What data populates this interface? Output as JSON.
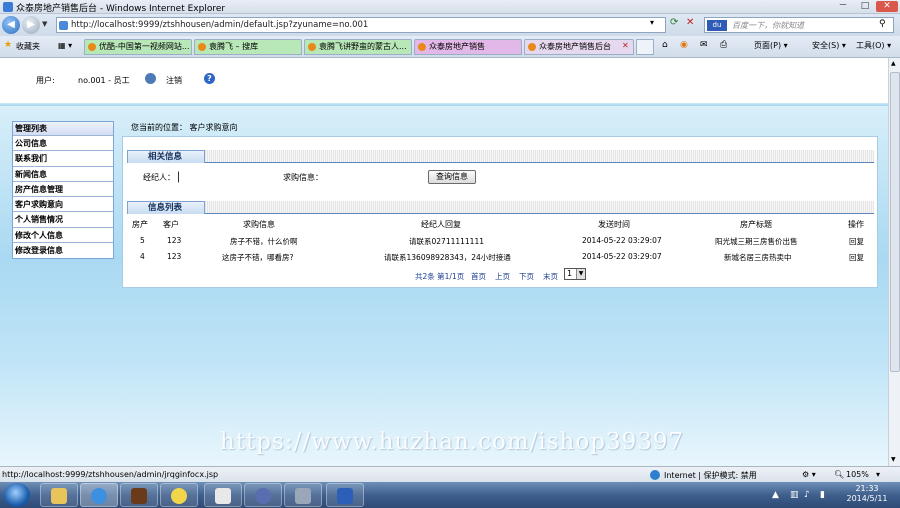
{
  "window": {
    "title": "众泰房地产销售后台 - Windows Internet Explorer",
    "minimize": "－",
    "maximize": "□",
    "close": "✕"
  },
  "addressbar": {
    "url": "http://localhost:9999/ztshhousen/admin/default.jsp?zyuname=no.001",
    "search_placeholder": "百度一下，你就知道"
  },
  "favorites_label": "收藏夹",
  "tabs": [
    {
      "label": "优酷-中国第一视频网站..."
    },
    {
      "label": "袁腾飞 – 搜库"
    },
    {
      "label": "袁腾飞讲野蛮的蒙古人..."
    },
    {
      "label": "众泰房地产销售"
    },
    {
      "label": "众泰房地产销售后台"
    }
  ],
  "commandbar": {
    "page": "页面(P) ▾",
    "safety": "安全(S) ▾",
    "tools": "工具(O) ▾"
  },
  "header": {
    "user_label": "用户:",
    "user_value": "no.001 - 员工",
    "logout": "注销",
    "help": "?"
  },
  "leftmenu": {
    "title": "管理列表",
    "items": [
      "公司信息",
      "联系我们",
      "新闻信息",
      "房产信息管理",
      "客户求购意向",
      "个人销售情况",
      "修改个人信息",
      "修改登录信息"
    ]
  },
  "breadcrumb": "您当前的位置： 客户求购意向",
  "search_section": {
    "title": "相关信息",
    "agent_label": "经纪人：",
    "info_label": "求购信息：",
    "agent_value": "",
    "info_value": "",
    "query_button": "查询信息"
  },
  "list_section": {
    "title": "信息列表",
    "columns": [
      "房产",
      "客户",
      "求购信息",
      "经纪人回复",
      "发送时间",
      "房产标题",
      "操作"
    ],
    "rows": [
      {
        "house": "5",
        "customer": "123",
        "request": "房子不错，什么价啊",
        "reply": "请联系02711111111",
        "time": "2014-05-22 03:29:07",
        "title": "阳光城三期三房售价出售",
        "action": "回复"
      },
      {
        "house": "4",
        "customer": "123",
        "request": "这房子不错，哪看房?",
        "reply": "请联系13609892834​3，24小时接通",
        "time": "2014-05-22 03:29:07",
        "title": "新城名居三房热卖中",
        "action": "回复"
      }
    ],
    "pager": {
      "summary": "共2条 第1/1页",
      "first": "首页",
      "prev": "上页",
      "next": "下页",
      "last": "末页",
      "current": "1"
    }
  },
  "watermark": "https://www.huzhan.com/ishop39397",
  "statusbar": {
    "link": "http://localhost:9999/ztshhousen/admin/jrqginfocx.jsp",
    "zone": "Internet | 保护模式: 禁用",
    "zoom": "105%"
  },
  "taskbar": {
    "time": "21:33",
    "date": "2014/5/11"
  }
}
